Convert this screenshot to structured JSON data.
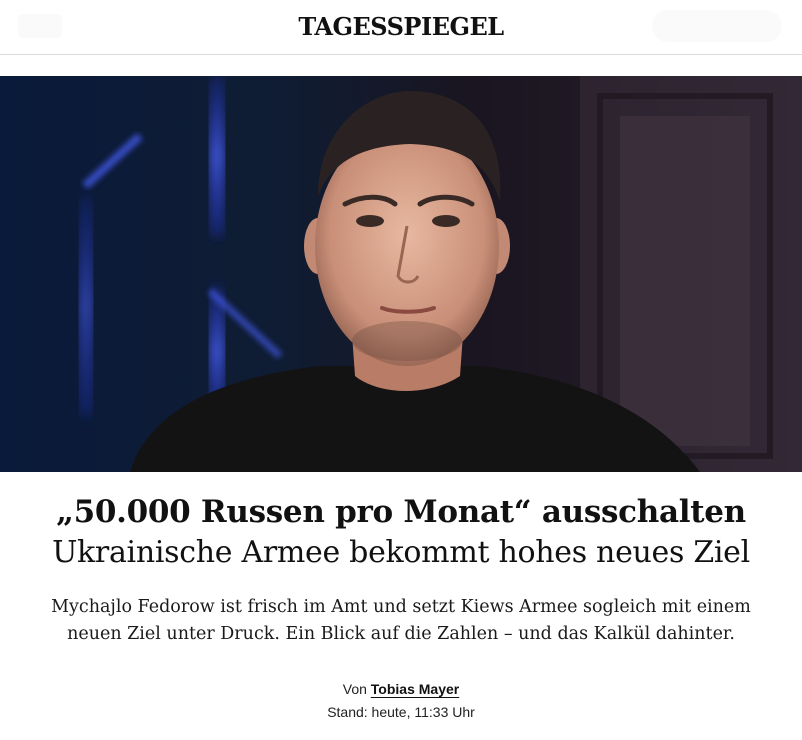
{
  "header": {
    "logo": "TAGESSPIEGEL"
  },
  "hero": {
    "image_icon": "portrait-photo"
  },
  "article": {
    "headline": "„50.000 Russen pro Monat“ ausschalten",
    "subheadline": "Ukrainische Armee bekommt hohes neues Ziel",
    "teaser_line1": "Mychajlo Fedorow ist frisch im Amt und setzt Kiews Armee sogleich mit einem",
    "teaser_line2": "neuen Ziel unter Druck. Ein Blick auf die Zahlen – und das Kalkül dahinter.",
    "byline_prefix": "Von",
    "author": "Tobias Mayer",
    "timestamp": "Stand: heute, 11:33 Uhr"
  },
  "colors": {
    "text": "#111111",
    "divider": "#d9d9d9",
    "hero_bg": "#0d1526",
    "accent_blue": "#3b5bff"
  }
}
